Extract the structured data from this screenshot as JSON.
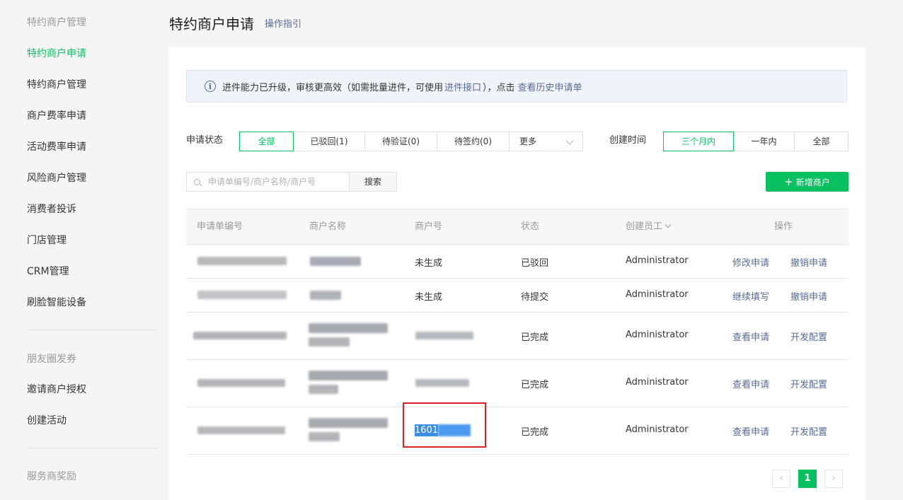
{
  "sidebar": {
    "groups": [
      "特约商户管理",
      "朋友圈发券",
      "服务商奖励"
    ],
    "items": [
      "特约商户申请",
      "特约商户管理",
      "商户费率申请",
      "活动费率申请",
      "风险商户管理",
      "消费者投诉",
      "门店管理",
      "CRM管理",
      "刷脸智能设备",
      "邀请商户授权",
      "创建活动"
    ]
  },
  "header": {
    "title": "特约商户申请",
    "guide_link": "操作指引"
  },
  "notice": {
    "icon": "info-icon",
    "text_before": "进件能力已升级，审核更高效（如需批量进件，可使用",
    "link1": "进件接口",
    "text_middle": "），点击",
    "link2": "查看历史申请单"
  },
  "filters": {
    "status_label": "申请状态",
    "status_options": [
      "全部",
      "已驳回(1)",
      "待验证(0)",
      "待签约(0)"
    ],
    "status_selected": "全部",
    "more_label": "更多",
    "time_label": "创建时间",
    "time_options": [
      "三个月内",
      "一年内",
      "全部"
    ],
    "time_selected": "三个月内"
  },
  "search": {
    "placeholder": "申请单编号/商户名称/商户号",
    "button": "搜索"
  },
  "add_button": "新增商户",
  "table": {
    "columns": [
      "申请单编号",
      "商户名称",
      "商户号",
      "状态",
      "创建员工",
      "操作"
    ],
    "rows": [
      {
        "merchant_no": "未生成",
        "status": "已驳回",
        "staff": "Administrator",
        "actions": [
          "修改申请",
          "撤销申请"
        ]
      },
      {
        "merchant_no": "未生成",
        "status": "待提交",
        "staff": "Administrator",
        "actions": [
          "继续填写",
          "撤销申请"
        ]
      },
      {
        "merchant_no": "",
        "status": "已完成",
        "staff": "Administrator",
        "actions": [
          "查看申请",
          "开发配置"
        ]
      },
      {
        "merchant_no": "",
        "status": "已完成",
        "staff": "Administrator",
        "actions": [
          "查看申请",
          "开发配置"
        ]
      },
      {
        "merchant_no": "1601",
        "status": "已完成",
        "staff": "Administrator",
        "actions": [
          "查看申请",
          "开发配置"
        ]
      }
    ]
  },
  "pagination": {
    "current": "1",
    "prev": "‹",
    "next": "›"
  },
  "colors": {
    "accent": "#07c160",
    "link": "#576b95",
    "highlight": "#e02020"
  }
}
